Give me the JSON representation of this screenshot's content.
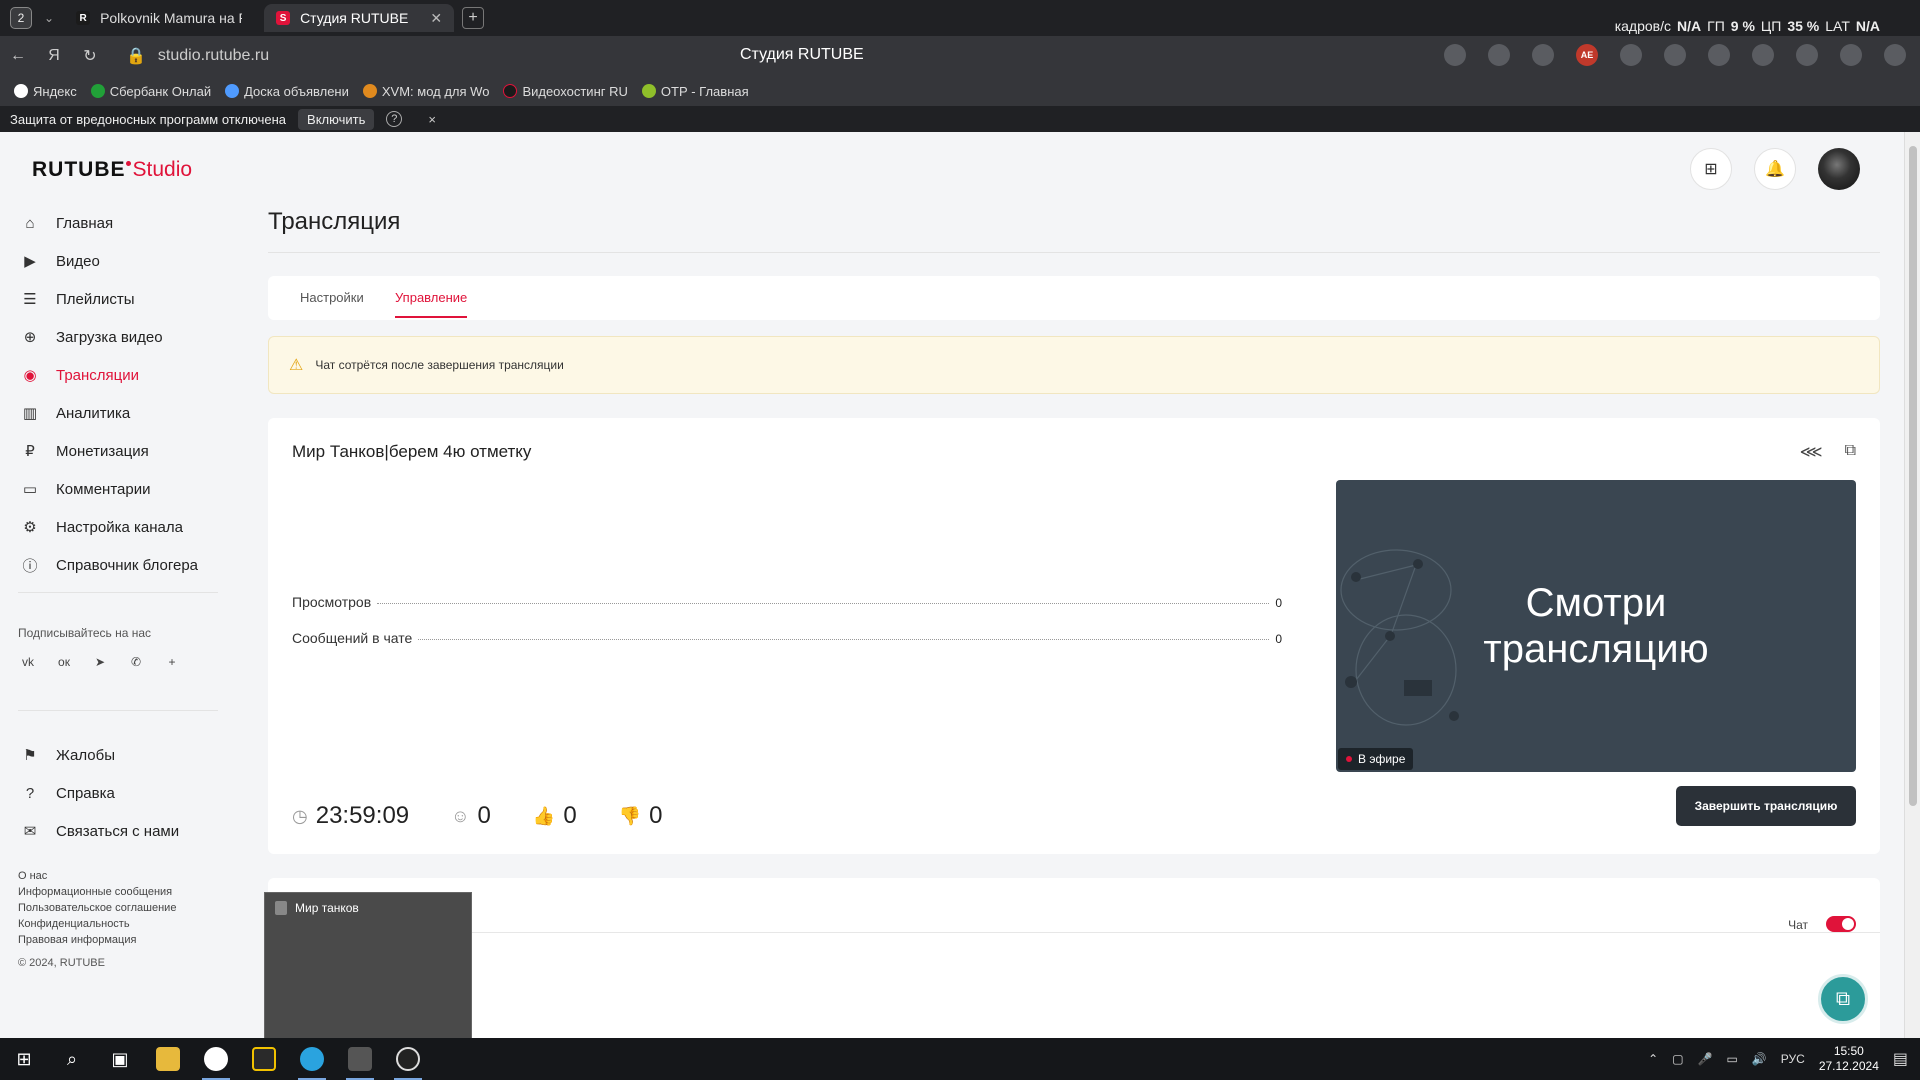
{
  "browser": {
    "tab_count": "2",
    "tabs": [
      {
        "label": "Polkovnik Mamura на RUT",
        "favicon": "R",
        "favicon_color": "#e0133a"
      },
      {
        "label": "Студия RUTUBE",
        "favicon": "S",
        "favicon_color": "#e0133a"
      }
    ],
    "stats": {
      "fps_label": "кадров/с",
      "fps_val": "N/A",
      "gpu_label": "ГП",
      "gpu_val": "9 %",
      "cpu_label": "ЦП",
      "cpu_val": "35 %",
      "lat_label": "LAT",
      "lat_val": "N/A"
    },
    "url": "studio.rutube.ru",
    "page_title": "Студия RUTUBE",
    "bookmarks": [
      {
        "label": "Яндекс",
        "color": "#ffffff"
      },
      {
        "label": "Сбербанк Онлай",
        "color": "#21a038"
      },
      {
        "label": "Доска объявлени",
        "color": "#4f9bff"
      },
      {
        "label": "XVM: мод для Wo",
        "color": "#e08a1e"
      },
      {
        "label": "Видеохостинг RU",
        "color": "#1b1b1b"
      },
      {
        "label": "ОТР - Главная",
        "color": "#8fbf2a"
      }
    ],
    "warning": {
      "text": "Защита от вредоносных программ отключена",
      "button": "Включить",
      "help": "?",
      "close": "×"
    }
  },
  "sidebar": {
    "logo_main": "RUTUBE",
    "logo_sub": "Studio",
    "items": [
      {
        "label": "Главная",
        "icon": "home-icon",
        "glyph": "⌂"
      },
      {
        "label": "Видео",
        "icon": "video-icon",
        "glyph": "▶"
      },
      {
        "label": "Плейлисты",
        "icon": "playlist-icon",
        "glyph": "☰"
      },
      {
        "label": "Загрузка видео",
        "icon": "upload-icon",
        "glyph": "⊕"
      },
      {
        "label": "Трансляции",
        "icon": "broadcast-icon",
        "glyph": "◉"
      },
      {
        "label": "Аналитика",
        "icon": "analytics-icon",
        "glyph": "▥"
      },
      {
        "label": "Монетизация",
        "icon": "money-icon",
        "glyph": "₽"
      },
      {
        "label": "Комментарии",
        "icon": "comment-icon",
        "glyph": "▭"
      },
      {
        "label": "Настройка канала",
        "icon": "settings-icon",
        "glyph": "⚙"
      },
      {
        "label": "Справочник блогера",
        "icon": "info-icon",
        "glyph": "ⓘ"
      }
    ],
    "follow_label": "Подписывайтесь на нас",
    "social": [
      {
        "icon": "vk-icon",
        "glyph": "vk"
      },
      {
        "icon": "ok-icon",
        "glyph": "ок"
      },
      {
        "icon": "telegram-icon",
        "glyph": "➤"
      },
      {
        "icon": "viber-icon",
        "glyph": "✆"
      },
      {
        "icon": "more-icon",
        "glyph": "+"
      }
    ],
    "items2": [
      {
        "label": "Жалобы",
        "icon": "flag-icon",
        "glyph": "⚑"
      },
      {
        "label": "Справка",
        "icon": "help-icon",
        "glyph": "?"
      },
      {
        "label": "Связаться с нами",
        "icon": "mail-icon",
        "glyph": "✉"
      }
    ],
    "footer_links": [
      "О нас",
      "Информационные сообщения",
      "Пользовательское соглашение",
      "Конфиденциальность",
      "Правовая информация"
    ],
    "copyright": "© 2024, RUTUBE"
  },
  "header": {
    "title": "Трансляция"
  },
  "page_tabs": [
    {
      "label": "Настройки"
    },
    {
      "label": "Управление"
    }
  ],
  "alert": {
    "text": "Чат сотрётся после завершения трансляции",
    "icon": "warning-icon"
  },
  "stream": {
    "title": "Мир Танков|берем 4ю отметку",
    "stats": [
      {
        "label": "Просмотров",
        "value": "0"
      },
      {
        "label": "Сообщений в чате",
        "value": "0"
      }
    ],
    "preview_line1": "Смотри",
    "preview_line2": "трансляцию",
    "live_badge": "В эфире",
    "duration": "23:59:09",
    "viewers": "0",
    "likes": "0",
    "dislikes": "0",
    "end_button": "Завершить трансляцию"
  },
  "chat": {
    "toggle_label": "Чат",
    "enabled": true
  },
  "taskbar_preview": {
    "title": "Мир танков"
  },
  "taskbar": {
    "lang": "РУС",
    "time": "15:50",
    "date": "27.12.2024"
  },
  "colors": {
    "accent": "#e0133a",
    "dark_button": "#2b3138",
    "alert_bg": "#fdf8e6"
  }
}
